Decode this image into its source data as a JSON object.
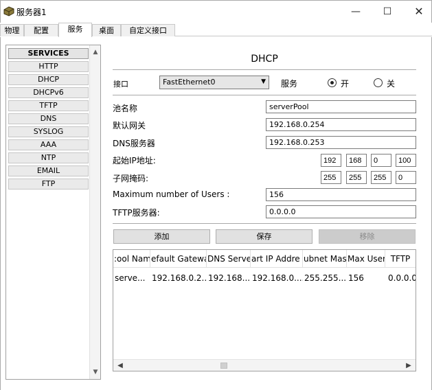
{
  "window": {
    "title": "服务器1",
    "minimize": "—",
    "maximize": "☐",
    "close": "✕"
  },
  "tabs": [
    {
      "label": "物理"
    },
    {
      "label": "配置"
    },
    {
      "label": "服务"
    },
    {
      "label": "桌面"
    },
    {
      "label": "自定义接口"
    }
  ],
  "sidebar": {
    "header": "SERVICES",
    "items": [
      "HTTP",
      "DHCP",
      "DHCPv6",
      "TFTP",
      "DNS",
      "SYSLOG",
      "AAA",
      "NTP",
      "EMAIL",
      "FTP"
    ]
  },
  "content": {
    "title": "DHCP",
    "interface_label": "接口",
    "interface_value": "FastEthernet0",
    "service_label": "服务",
    "on_label": "开",
    "off_label": "关",
    "service_on": true
  },
  "form": {
    "pool_name_label": "池名称",
    "pool_name_value": "serverPool",
    "gateway_label": "默认网关",
    "gateway_value": "192.168.0.254",
    "dns_label": "DNS服务器",
    "dns_value": "192.168.0.253",
    "start_ip_label": "起始IP地址:",
    "start_ip": [
      "192",
      "168",
      "0",
      "100"
    ],
    "subnet_label": "子网掩码:",
    "subnet": [
      "255",
      "255",
      "255",
      "0"
    ],
    "max_users_label": "Maximum number of Users :",
    "max_users_value": "156",
    "tftp_label": "TFTP服务器:",
    "tftp_value": "0.0.0.0"
  },
  "buttons": {
    "add": "添加",
    "save": "保存",
    "remove": "移除"
  },
  "table": {
    "headers": [
      ":ool Nam",
      "efault Gatewa",
      "DNS Serve",
      "art IP Addre",
      "ubnet Mas",
      "Max User",
      "TFTP"
    ],
    "rows": [
      [
        "serve...",
        "192.168.0.2...",
        "192.168....",
        "192.168.0....",
        "255.255....",
        "156",
        "0.0.0.0"
      ]
    ]
  },
  "scroll": {
    "up": "▲",
    "down": "▼",
    "left": "◀",
    "right": "▶"
  }
}
